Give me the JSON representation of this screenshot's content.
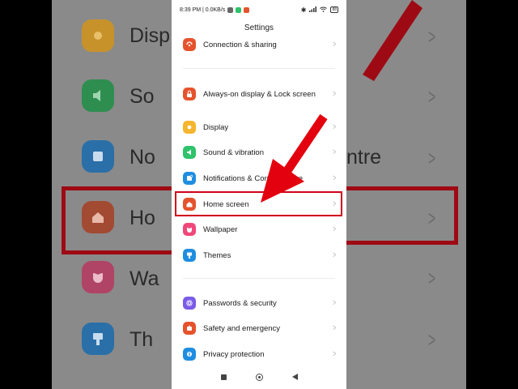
{
  "status_bar": {
    "time_speed": "8:39 PM | 0.0KB/s",
    "battery": "88"
  },
  "header": {
    "title": "Settings"
  },
  "settings": {
    "connection": "Connection & sharing",
    "always_on": "Always-on display & Lock screen",
    "display": "Display",
    "sound": "Sound & vibration",
    "notifications": "Notifications & Control centre",
    "home_screen": "Home screen",
    "wallpaper": "Wallpaper",
    "themes": "Themes",
    "passwords": "Passwords & security",
    "safety": "Safety and emergency",
    "privacy": "Privacy protection"
  },
  "background_zoom": {
    "left_labels": [
      "Disp",
      "So",
      "No",
      "Ho",
      "Wa",
      "Th"
    ],
    "right_labels": [
      "ntre"
    ]
  },
  "colors": {
    "highlight": "#d0021b",
    "arrow": "#e3000f",
    "display_icon": "#f5b52e",
    "sound_icon": "#2ec26a",
    "notifications_icon": "#1f8ee0",
    "home_icon": "#e5532d",
    "wallpaper_icon": "#f0487a",
    "themes_icon": "#1f8ee0",
    "lock_icon": "#e5532d",
    "connection_icon": "#e5532d",
    "passwords_icon": "#7b5be8",
    "safety_icon": "#e5532d",
    "privacy_icon": "#1f8ee0"
  },
  "icons": {
    "connection": "connection-icon",
    "always_on": "lock-icon",
    "display": "sun-icon",
    "sound": "speaker-icon",
    "notifications": "notification-icon",
    "home_screen": "home-icon",
    "wallpaper": "tulip-icon",
    "themes": "brush-icon",
    "passwords": "fingerprint-icon",
    "safety": "emergency-icon",
    "privacy": "privacy-icon"
  }
}
